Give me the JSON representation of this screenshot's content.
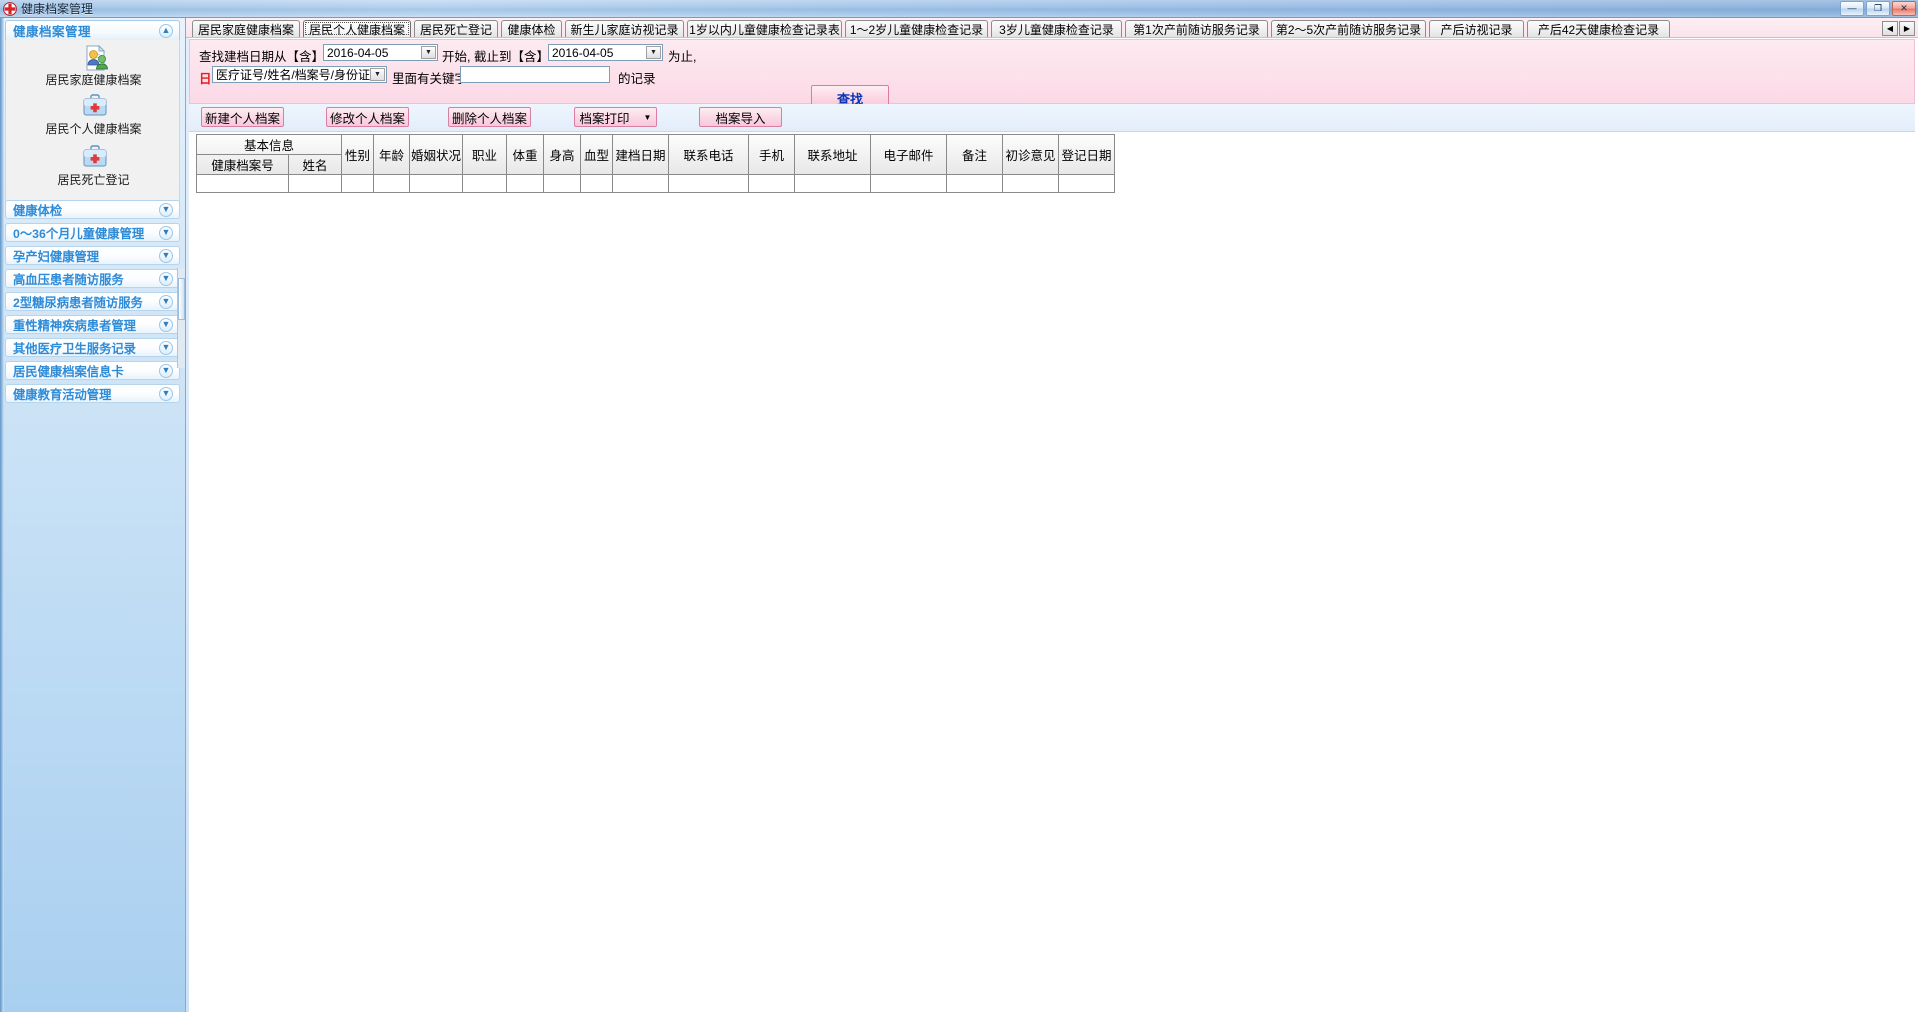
{
  "window": {
    "title": "健康档案管理",
    "icon": "medical-cross-icon",
    "minimize_label": "—",
    "maximize_label": "❐",
    "close_label": "✕"
  },
  "sidebar": {
    "header": {
      "title": "健康档案管理",
      "collapse_icon": "chevron-up-icon"
    },
    "shortcuts": [
      {
        "label": "居民家庭健康档案",
        "icon": "family-record-icon"
      },
      {
        "label": "居民个人健康档案",
        "icon": "medical-case-icon"
      },
      {
        "label": "居民死亡登记",
        "icon": "medical-case-icon"
      }
    ],
    "accordion": [
      {
        "label": "健康体检",
        "icon": "chevron-down-icon"
      },
      {
        "label": "0～36个月儿童健康管理",
        "icon": "chevron-down-icon"
      },
      {
        "label": "孕产妇健康管理",
        "icon": "chevron-down-icon"
      },
      {
        "label": "高血压患者随访服务",
        "icon": "chevron-down-icon"
      },
      {
        "label": "2型糖尿病患者随访服务",
        "icon": "chevron-down-icon"
      },
      {
        "label": "重性精神疾病患者管理",
        "icon": "chevron-down-icon"
      },
      {
        "label": "其他医疗卫生服务记录",
        "icon": "chevron-down-icon"
      },
      {
        "label": "居民健康档案信息卡",
        "icon": "chevron-down-icon"
      },
      {
        "label": "健康教育活动管理",
        "icon": "chevron-down-icon"
      }
    ]
  },
  "tabs": {
    "items": [
      {
        "label": "居民家庭健康档案",
        "active": false
      },
      {
        "label": "居民个人健康档案",
        "active": true
      },
      {
        "label": "居民死亡登记",
        "active": false
      },
      {
        "label": "健康体检",
        "active": false
      },
      {
        "label": "新生儿家庭访视记录",
        "active": false
      },
      {
        "label": "1岁以内儿童健康检查记录表",
        "active": false
      },
      {
        "label": "1～2岁儿童健康检查记录",
        "active": false
      },
      {
        "label": "3岁儿童健康检查记录",
        "active": false
      },
      {
        "label": "第1次产前随访服务记录",
        "active": false
      },
      {
        "label": "第2～5次产前随访服务记录",
        "active": false
      },
      {
        "label": "产后访视记录",
        "active": false
      },
      {
        "label": "产后42天健康检查记录",
        "active": false
      }
    ],
    "scroll_left_icon": "chevron-left-icon",
    "scroll_right_icon": "chevron-right-icon"
  },
  "query": {
    "label_from": "查找建档日期从【含】",
    "date_from": "2016-04-05",
    "label_start": "开始, 截止到【含】",
    "date_to": "2016-04-05",
    "label_until": "为止,",
    "field_marker": "日",
    "field_select": "医疗证号/姓名/档案号/身份证",
    "label_keyword": "里面有关键字",
    "keyword_value": "",
    "keyword_placeholder": "",
    "label_records": "的记录",
    "find_button": "查找",
    "dropdown_icon": "chevron-down-icon"
  },
  "toolbar": {
    "new_label": "新建个人档案",
    "edit_label": "修改个人档案",
    "delete_label": "删除个人档案",
    "print_label": "档案打印",
    "print_dropdown_icon": "caret-down-icon",
    "import_label": "档案导入"
  },
  "grid": {
    "group_header": "基本信息",
    "group_subcolumns": [
      "健康档案号",
      "姓名"
    ],
    "columns": [
      "性别",
      "年龄",
      "婚姻状况",
      "职业",
      "体重",
      "身高",
      "血型",
      "建档日期",
      "联系电话",
      "手机",
      "联系地址",
      "电子邮件",
      "备注",
      "初诊意见",
      "登记日期"
    ],
    "rows": []
  },
  "colors": {
    "accent_blue": "#2e8bd8",
    "pink_band": "#fbd9e6",
    "button_pink": "#f8c8da",
    "find_text_blue": "#0a34b5",
    "red_marker": "#e02020"
  }
}
